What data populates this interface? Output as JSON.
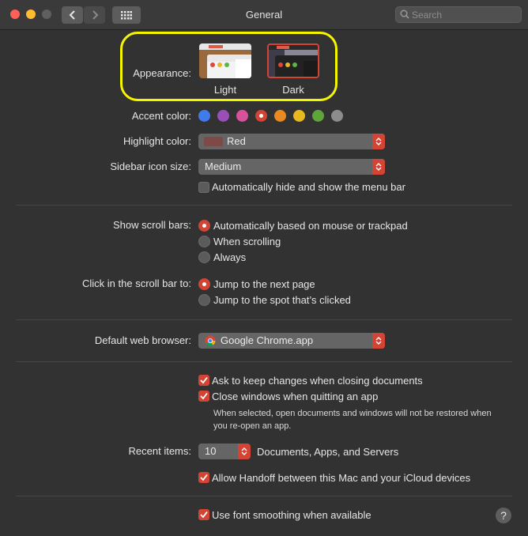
{
  "window": {
    "title": "General",
    "search_placeholder": "Search",
    "back_icon": "chevron-left-icon",
    "forward_icon": "chevron-right-icon",
    "grid_icon": "show-all-grid-icon"
  },
  "appearance": {
    "label": "Appearance:",
    "options": [
      {
        "label": "Light",
        "selected": false
      },
      {
        "label": "Dark",
        "selected": true
      }
    ],
    "highlight_outline_color": "#f5f500"
  },
  "accent": {
    "label": "Accent color:",
    "colors": [
      "#3f7bea",
      "#9a4fb8",
      "#d9519c",
      "#d44435",
      "#e88a20",
      "#e8b820",
      "#5ea53a",
      "#8c8c8c"
    ],
    "selected_index": 3
  },
  "highlight": {
    "label": "Highlight color:",
    "value": "Red",
    "swatch_color": "#7d4a47"
  },
  "sidebar_icon": {
    "label": "Sidebar icon size:",
    "value": "Medium"
  },
  "menu_bar": {
    "label": "Automatically hide and show the menu bar",
    "checked": false
  },
  "scroll_bars": {
    "label": "Show scroll bars:",
    "options": [
      {
        "label": "Automatically based on mouse or trackpad",
        "selected": true
      },
      {
        "label": "When scrolling",
        "selected": false
      },
      {
        "label": "Always",
        "selected": false
      }
    ]
  },
  "scroll_click": {
    "label": "Click in the scroll bar to:",
    "options": [
      {
        "label": "Jump to the next page",
        "selected": true
      },
      {
        "label": "Jump to the spot that’s clicked",
        "selected": false
      }
    ]
  },
  "browser": {
    "label": "Default web browser:",
    "value": "Google Chrome.app",
    "icon": "chrome-icon"
  },
  "documents": {
    "ask_keep": {
      "label": "Ask to keep changes when closing documents",
      "checked": true
    },
    "close_windows": {
      "label": "Close windows when quitting an app",
      "checked": true
    },
    "note": "When selected, open documents and windows will not be restored when you re-open an app."
  },
  "recent": {
    "label": "Recent items:",
    "value": "10",
    "suffix": "Documents, Apps, and Servers"
  },
  "handoff": {
    "label": "Allow Handoff between this Mac and your iCloud devices",
    "checked": true
  },
  "font_smoothing": {
    "label": "Use font smoothing when available",
    "checked": true
  },
  "help": {
    "label": "?"
  },
  "colors": {
    "accent": "#d44435",
    "background": "#323232",
    "titlebar": "#3a3a3a"
  }
}
